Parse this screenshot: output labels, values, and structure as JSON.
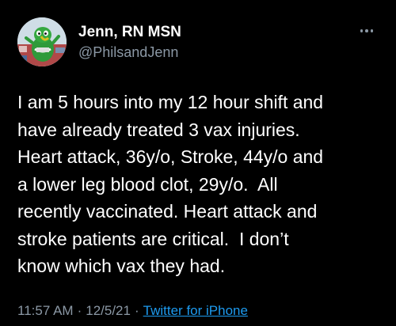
{
  "tweet": {
    "author": {
      "display_name": "Jenn, RN MSN",
      "handle": "@PhilsandJenn"
    },
    "more_icon": "more-horizontal-icon",
    "body_lines": [
      "I am 5 hours into my 12 hour shift and",
      "have already treated 3 vax injuries.",
      "Heart attack, 36y/o, Stroke, 44y/o and",
      "a lower leg blood clot, 29y/o.  All",
      "recently vaccinated. Heart attack and",
      "stroke patients are critical.  I don’t",
      "know which vax they had."
    ],
    "meta": {
      "time": "11:57 AM",
      "separator": "·",
      "date": "12/5/21",
      "source": "Twitter for iPhone"
    }
  },
  "colors": {
    "background": "#000000",
    "text_primary": "#ffffff",
    "text_secondary": "#8b98a5",
    "link": "#1d9bf0"
  }
}
